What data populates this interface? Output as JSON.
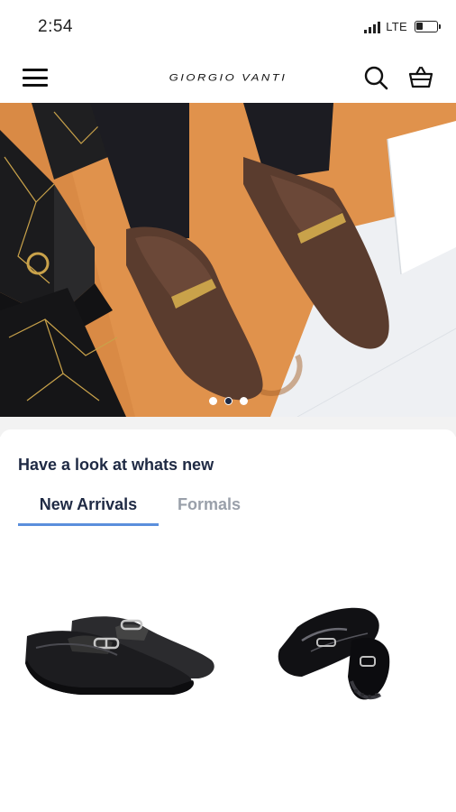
{
  "status_bar": {
    "time": "2:54",
    "network": "LTE",
    "battery_level": 0.35
  },
  "header": {
    "brand": "GIORGIO VANTI",
    "menu_icon": "hamburger-icon",
    "search_icon": "search-icon",
    "cart_icon": "shopping-basket-icon"
  },
  "hero": {
    "slide_count": 3,
    "active_slide": 2
  },
  "section": {
    "title": "Have a look at whats new"
  },
  "tabs": [
    {
      "label": "New Arrivals",
      "active": true
    },
    {
      "label": "Formals",
      "active": false
    }
  ],
  "products": [
    {
      "image": "black-leather-loafer-with-buckle"
    },
    {
      "image": "black-patent-loafer-pair"
    }
  ],
  "colors": {
    "accent": "#5b8fdc",
    "text_dark": "#1f2a44",
    "text_muted": "#9aa0aa",
    "hero_floor": "#d98a45"
  }
}
